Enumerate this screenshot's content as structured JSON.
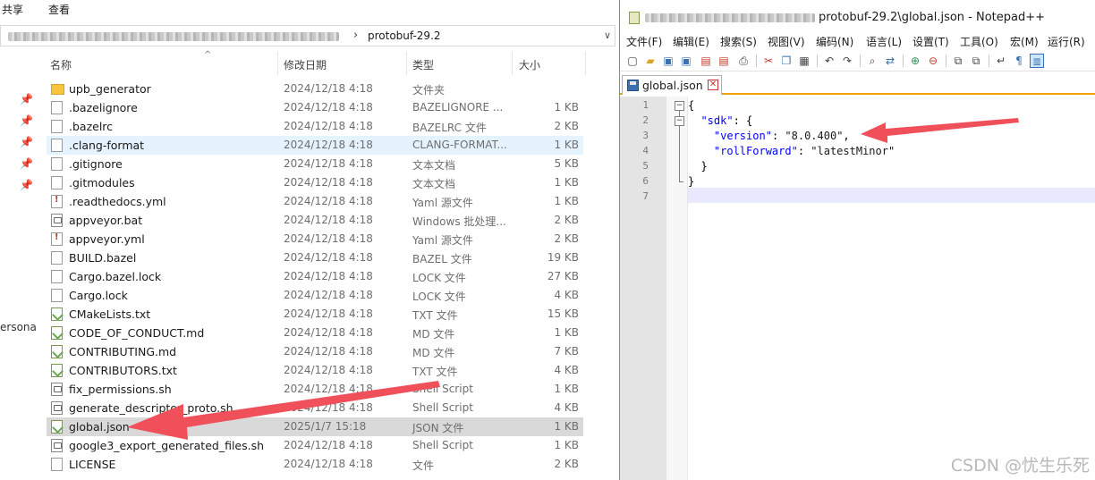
{
  "explorer": {
    "ribbon": {
      "share": "共享",
      "view": "查看"
    },
    "address": {
      "current": "protobuf-29.2"
    },
    "columns": {
      "name": "名称",
      "date": "修改日期",
      "type": "类型",
      "size": "大小"
    },
    "nav_label": "ersona",
    "files": [
      {
        "name": "upb_generator",
        "date": "2024/12/18 4:18",
        "type": "文件夹",
        "size": "",
        "icon": "folder-icon"
      },
      {
        "name": ".bazelignore",
        "date": "2024/12/18 4:18",
        "type": "BAZELIGNORE ...",
        "size": "1 KB",
        "icon": "file-icon"
      },
      {
        "name": ".bazelrc",
        "date": "2024/12/18 4:18",
        "type": "BAZELRC 文件",
        "size": "2 KB",
        "icon": "file-icon"
      },
      {
        "name": ".clang-format",
        "date": "2024/12/18 4:18",
        "type": "CLANG-FORMAT...",
        "size": "1 KB",
        "icon": "file-icon"
      },
      {
        "name": ".gitignore",
        "date": "2024/12/18 4:18",
        "type": "文本文档",
        "size": "5 KB",
        "icon": "file-icon"
      },
      {
        "name": ".gitmodules",
        "date": "2024/12/18 4:18",
        "type": "文本文档",
        "size": "1 KB",
        "icon": "file-icon"
      },
      {
        "name": ".readthedocs.yml",
        "date": "2024/12/18 4:18",
        "type": "Yaml 源文件",
        "size": "1 KB",
        "icon": "yaml-file-icon"
      },
      {
        "name": "appveyor.bat",
        "date": "2024/12/18 4:18",
        "type": "Windows 批处理...",
        "size": "2 KB",
        "icon": "batch-file-icon"
      },
      {
        "name": "appveyor.yml",
        "date": "2024/12/18 4:18",
        "type": "Yaml 源文件",
        "size": "2 KB",
        "icon": "yaml-file-icon"
      },
      {
        "name": "BUILD.bazel",
        "date": "2024/12/18 4:18",
        "type": "BAZEL 文件",
        "size": "19 KB",
        "icon": "file-icon"
      },
      {
        "name": "Cargo.bazel.lock",
        "date": "2024/12/18 4:18",
        "type": "LOCK 文件",
        "size": "27 KB",
        "icon": "file-icon"
      },
      {
        "name": "Cargo.lock",
        "date": "2024/12/18 4:18",
        "type": "LOCK 文件",
        "size": "4 KB",
        "icon": "file-icon"
      },
      {
        "name": "CMakeLists.txt",
        "date": "2024/12/18 4:18",
        "type": "TXT 文件",
        "size": "15 KB",
        "icon": "text-file-icon"
      },
      {
        "name": "CODE_OF_CONDUCT.md",
        "date": "2024/12/18 4:18",
        "type": "MD 文件",
        "size": "1 KB",
        "icon": "text-file-icon"
      },
      {
        "name": "CONTRIBUTING.md",
        "date": "2024/12/18 4:18",
        "type": "MD 文件",
        "size": "7 KB",
        "icon": "text-file-icon"
      },
      {
        "name": "CONTRIBUTORS.txt",
        "date": "2024/12/18 4:18",
        "type": "TXT 文件",
        "size": "4 KB",
        "icon": "text-file-icon"
      },
      {
        "name": "fix_permissions.sh",
        "date": "2024/12/18 4:18",
        "type": "Shell Script",
        "size": "1 KB",
        "icon": "script-file-icon"
      },
      {
        "name": "generate_descriptor_proto.sh",
        "date": "2024/12/18 4:18",
        "type": "Shell Script",
        "size": "4 KB",
        "icon": "script-file-icon"
      },
      {
        "name": "global.json",
        "date": "2025/1/7 15:18",
        "type": "JSON 文件",
        "size": "1 KB",
        "icon": "text-file-icon"
      },
      {
        "name": "google3_export_generated_files.sh",
        "date": "2024/12/18 4:18",
        "type": "Shell Script",
        "size": "1 KB",
        "icon": "script-file-icon"
      },
      {
        "name": "LICENSE",
        "date": "2024/12/18 4:18",
        "type": "文件",
        "size": "2 KB",
        "icon": "file-icon"
      }
    ]
  },
  "notepad": {
    "title": "protobuf-29.2\\global.json - Notepad++",
    "menu": [
      "文件(F)",
      "编辑(E)",
      "搜索(S)",
      "视图(V)",
      "编码(N)",
      "语言(L)",
      "设置(T)",
      "工具(O)",
      "宏(M)",
      "运行(R)"
    ],
    "tab": "global.json",
    "line_numbers": [
      "1",
      "2",
      "3",
      "4",
      "5",
      "6",
      "7"
    ],
    "code": {
      "l1": "{",
      "l2_key": "\"sdk\"",
      "l2_rest": ": {",
      "l3_key": "\"version\"",
      "l3_sep": ": ",
      "l3_val": "\"8.0.400\"",
      "l3_end": ",",
      "l4_key": "\"rollForward\"",
      "l4_sep": ": ",
      "l4_val": "\"latestMinor\"",
      "l5": "}",
      "l6": "}"
    }
  },
  "watermark": "CSDN @忧生乐死",
  "colors": {
    "arrow": "#f0505a",
    "selection": "#cce8ff",
    "tab_accent": "#f0a000"
  }
}
